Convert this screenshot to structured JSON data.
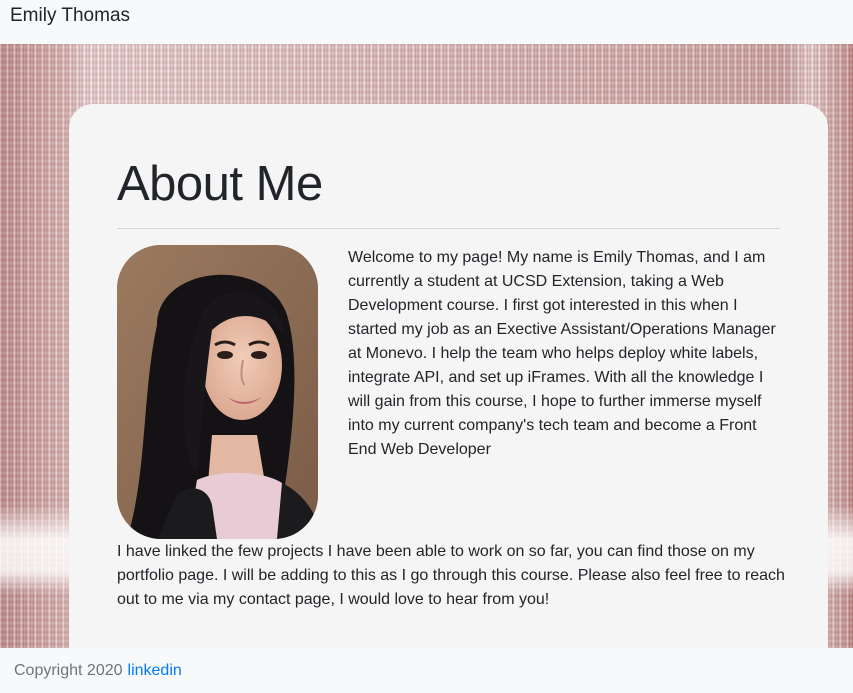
{
  "navbar": {
    "brand": "Emily Thomas"
  },
  "main": {
    "title": "About Me",
    "portrait_alt": "Emily Thomas",
    "intro": "Welcome to my page! My name is Emily Thomas, and I am currently a student at UCSD Extension, taking a Web Development course. I first got interested in this when I started my job as an Exective Assistant/Operations Manager at Monevo. I help the team who helps deploy white labels, integrate API, and set up iFrames. With all the knowledge I will gain from this course, I hope to further immerse myself into my current company's tech team and become a Front End Web Developer",
    "more": "I have linked the few projects I have been able to work on so far, you can find those on my portfolio page. I will be adding to this as I go through this course. Please also feel free to reach out to me via my contact page, I would love to hear from you!"
  },
  "footer": {
    "copyright": "Copyright 2020",
    "link_label": "linkedin"
  },
  "colors": {
    "link": "#007bff",
    "card": "#f5f5f5",
    "background": "#c79a98"
  }
}
